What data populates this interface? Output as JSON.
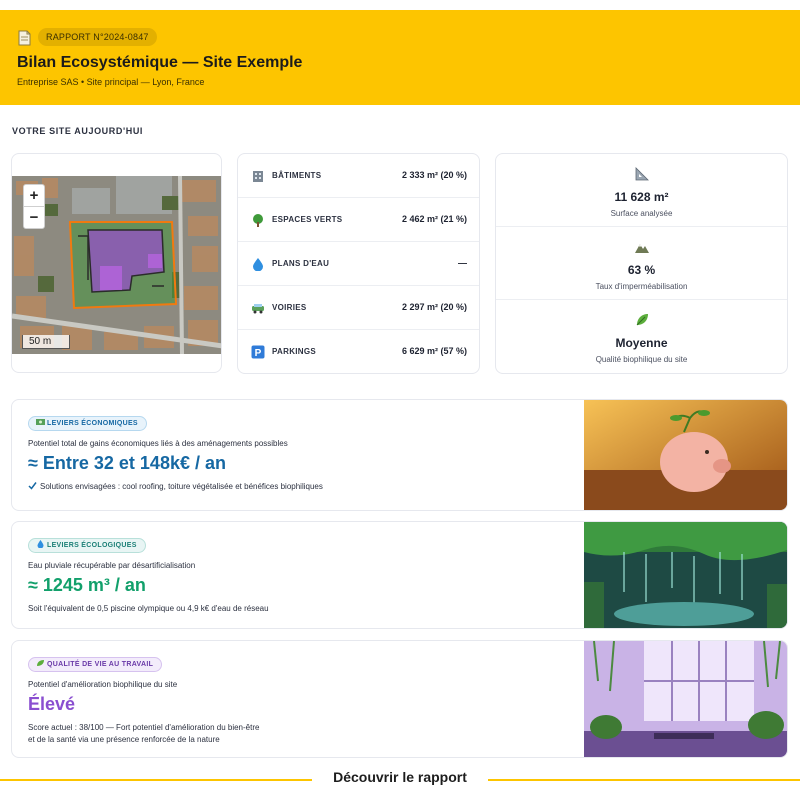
{
  "colors": {
    "brand_yellow": "#fdc500",
    "economic_blue": "#1668a3",
    "ecologic_green": "#12a06b",
    "quality_purple": "#8a4fd0"
  },
  "header": {
    "badge": "RAPPORT N°2024-0847",
    "title": "Bilan Ecosystémique — Site Exemple",
    "subtitle": "Entreprise SAS • Site principal — Lyon, France",
    "icon": "document-icon"
  },
  "site": {
    "section_title": "VOTRE SITE AUJOURD'HUI",
    "map": {
      "zoom_in": "+",
      "zoom_out": "−",
      "scale": "50 m"
    },
    "surfaces": [
      {
        "label": "BÂTIMENTS",
        "value": "2 333 m² (20 %)",
        "icon": "building-icon"
      },
      {
        "label": "ESPACES VERTS",
        "value": "2 462 m² (21 %)",
        "icon": "tree-icon"
      },
      {
        "label": "PLANS D'EAU",
        "value": "—",
        "icon": "water-drop-icon"
      },
      {
        "label": "VOIRIES",
        "value": "2 297 m² (20 %)",
        "icon": "car-icon"
      },
      {
        "label": "PARKINGS",
        "value": "6 629 m² (57 %)",
        "icon": "parking-icon"
      }
    ],
    "stats": [
      {
        "value": "11 628 m²",
        "label": "Surface analysée",
        "icon": "ruler-icon"
      },
      {
        "value": "63 %",
        "label": "Taux d'imperméabilisation",
        "icon": "mountain-icon"
      },
      {
        "value": "Moyenne",
        "label": "Qualité biophilique du site",
        "icon": "leaf-icon"
      }
    ]
  },
  "levers": {
    "economic": {
      "tag": "LEVIERS ÉCONOMIQUES",
      "desc": "Potentiel total de gains économiques liés à des aménagements possibles",
      "big": "≈ Entre 32 et 148k€ / an",
      "foot": "Solutions envisagées : cool roofing, toiture végétalisée et bénéfices biophiliques",
      "icon": "money-icon",
      "image": "piggy-bank-image"
    },
    "ecologic": {
      "tag": "LEVIERS ÉCOLOGIQUES",
      "desc": "Eau pluviale récupérable par désartificialisation",
      "big": "≈ 1245 m³ / an",
      "foot": "Soit l'équivalent de 0,5 piscine olympique ou 4,9 k€ d'eau de réseau",
      "icon": "water-drop-icon",
      "image": "green-roof-rain-image"
    },
    "quality": {
      "tag": "QUALITÉ DE VIE AU TRAVAIL",
      "desc": "Potentiel d'amélioration biophilique du site",
      "big": "Élevé",
      "foot_line1": "Score actuel : 38/100 — Fort potentiel d'amélioration du bien-être",
      "foot_line2": "et de la santé via une présence renforcée de la nature",
      "icon": "leaf-icon",
      "image": "plant-office-image"
    }
  },
  "footer": {
    "cta": "Découvrir le rapport"
  }
}
